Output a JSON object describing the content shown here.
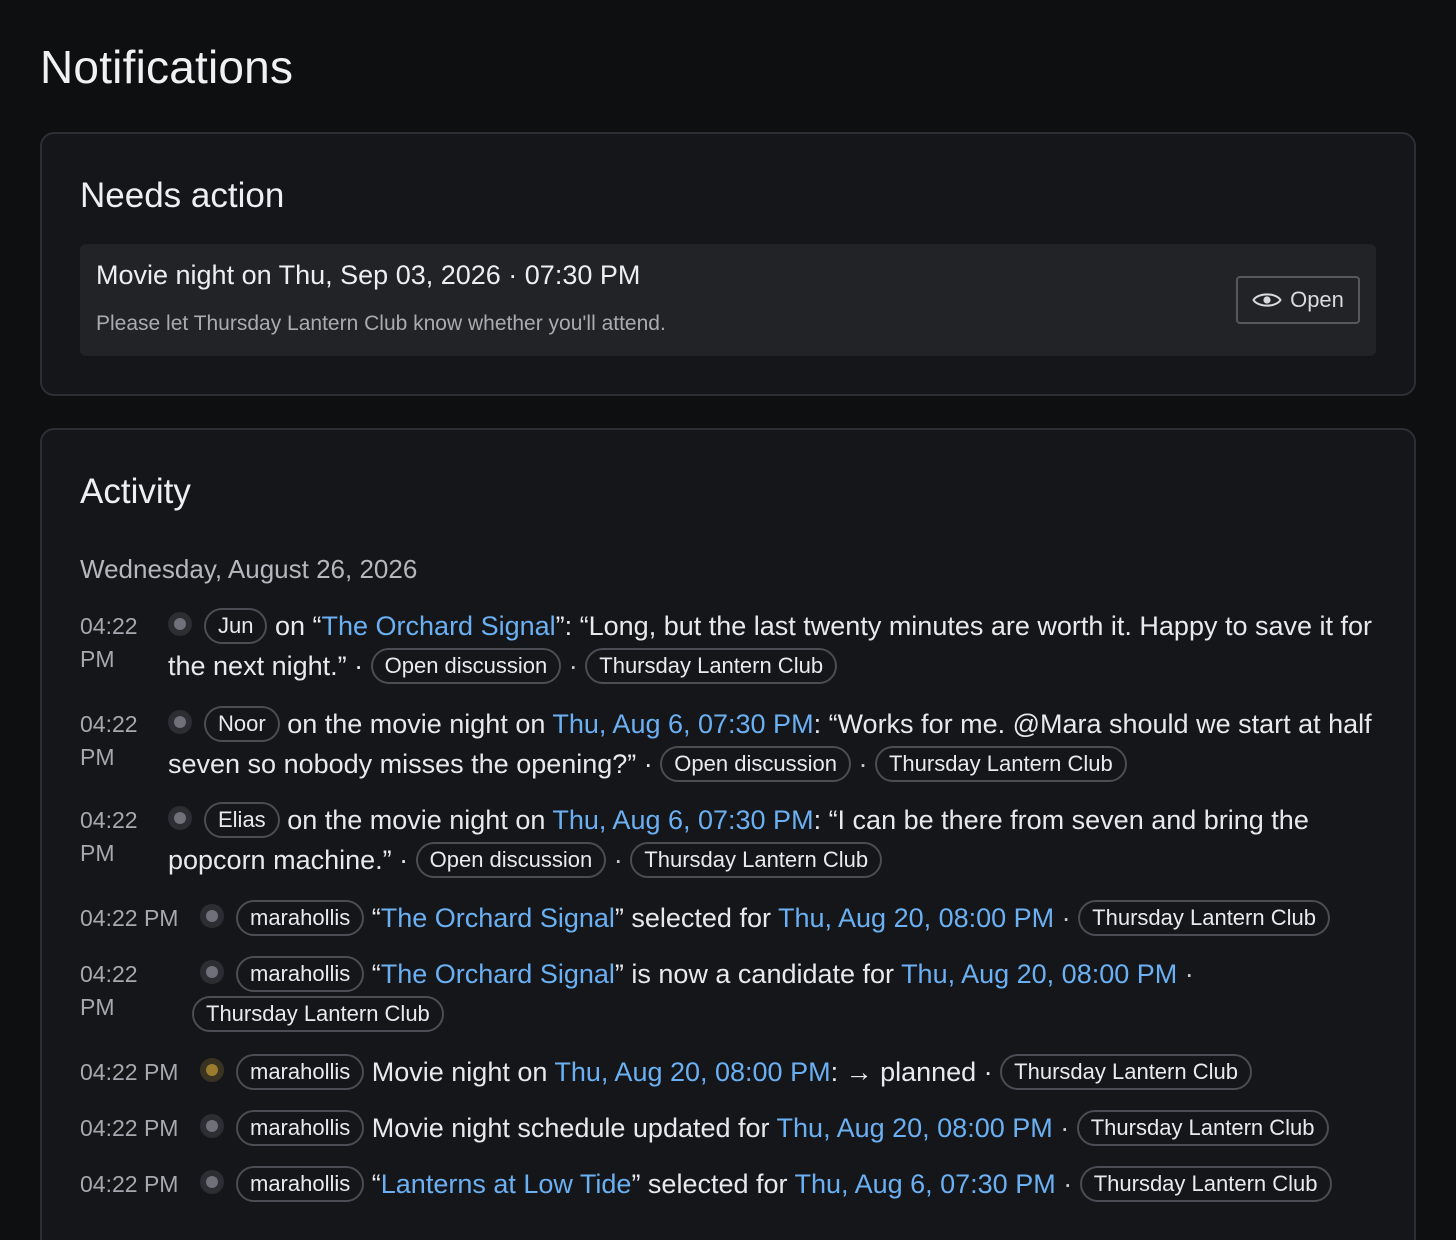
{
  "page": {
    "title": "Notifications"
  },
  "needs_action": {
    "title": "Needs action",
    "item": {
      "title": "Movie night on Thu, Sep 03, 2026 · 07:30 PM",
      "subtitle": "Please let Thursday Lantern Club know whether you'll attend.",
      "button_label": "Open"
    }
  },
  "activity": {
    "title": "Activity",
    "date": "Wednesday, August 26, 2026",
    "rows": [
      {
        "time": "04:22 PM",
        "user": "Jun",
        "pre": " on “",
        "link1": "The Orchard Signal",
        "mid": "”: “Long, but the last twenty minutes are worth it. Happy to save it for the next night.” · ",
        "tag1": "Open discussion",
        "tag2": "Thursday Lantern Club"
      },
      {
        "time": "04:22 PM",
        "user": "Noor",
        "pre": " on the movie night on ",
        "link1": "Thu, Aug 6, 07:30 PM",
        "mid": ": “Works for me. @Mara should we start at half seven so nobody misses the opening?” · ",
        "tag1": "Open discussion",
        "tag2": "Thursday Lantern Club"
      },
      {
        "time": "04:22 PM",
        "user": "Elias",
        "pre": " on the movie night on ",
        "link1": "Thu, Aug 6, 07:30 PM",
        "mid": ": “I can be there from seven and bring the popcorn machine.” · ",
        "tag1": "Open discussion",
        "tag2": "Thursday Lantern Club"
      },
      {
        "time": "04:22 PM",
        "user": "marahollis",
        "pre": " “",
        "link1": "The Orchard Signal",
        "mid": "” selected for ",
        "link2": "Thu, Aug 20, 08:00 PM",
        "tag2": "Thursday Lantern Club"
      },
      {
        "time": "04:22 PM",
        "user": "marahollis",
        "pre": " “",
        "link1": "The Orchard Signal",
        "mid": "” is now a candidate for ",
        "link2": "Thu, Aug 20, 08:00 PM",
        "tag2": "Thursday Lantern Club"
      },
      {
        "time": "04:22 PM",
        "user": "marahollis",
        "pre": " Movie night on ",
        "link1": "Thu, Aug 20, 08:00 PM",
        "mid": ": → planned · ",
        "tag2": "Thursday Lantern Club"
      },
      {
        "time": "04:22 PM",
        "user": "marahollis",
        "pre": " Movie night schedule updated for ",
        "link1": "Thu, Aug 20, 08:00 PM",
        "tag2": "Thursday Lantern Club"
      },
      {
        "time": "04:22 PM",
        "user": "marahollis",
        "pre": " “",
        "link1": "Lanterns at Low Tide",
        "mid": "” selected for ",
        "link2": "Thu, Aug 6, 07:30 PM",
        "tag2": "Thursday Lantern Club"
      }
    ]
  }
}
